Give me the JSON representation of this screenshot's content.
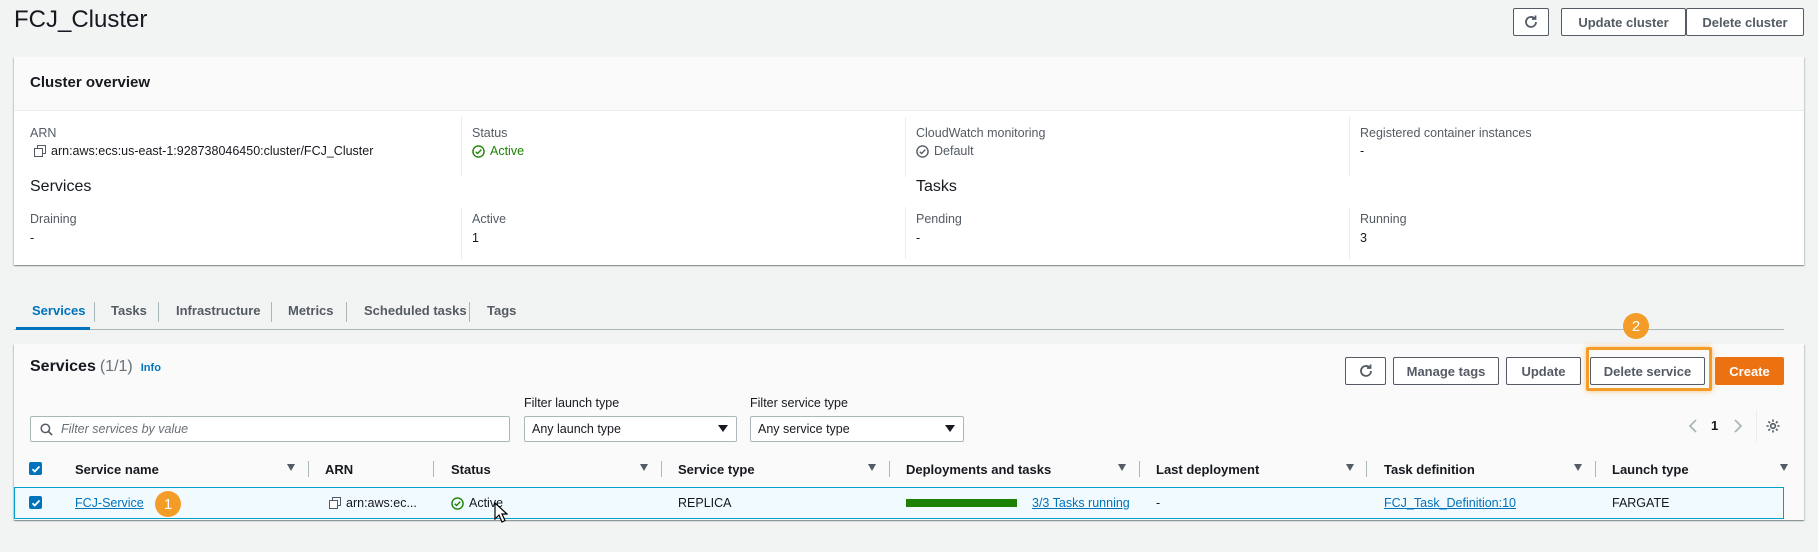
{
  "header": {
    "title": "FCJ_Cluster",
    "update_cluster": "Update cluster",
    "delete_cluster": "Delete cluster"
  },
  "overview": {
    "heading": "Cluster overview",
    "arn_label": "ARN",
    "arn_value": "arn:aws:ecs:us-east-1:928738046450:cluster/FCJ_Cluster",
    "status_label": "Status",
    "status_value": "Active",
    "cloudwatch_label": "CloudWatch monitoring",
    "cloudwatch_value": "Default",
    "registered_label": "Registered container instances",
    "registered_value": "-",
    "services_heading": "Services",
    "draining_label": "Draining",
    "draining_value": "-",
    "active_label": "Active",
    "active_value": "1",
    "tasks_heading": "Tasks",
    "pending_label": "Pending",
    "pending_value": "-",
    "running_label": "Running",
    "running_value": "3"
  },
  "tabs": [
    "Services",
    "Tasks",
    "Infrastructure",
    "Metrics",
    "Scheduled tasks",
    "Tags"
  ],
  "services": {
    "heading": "Services",
    "count": "(1/1)",
    "info": "Info",
    "manage_tags": "Manage tags",
    "update": "Update",
    "delete_service": "Delete service",
    "create": "Create",
    "search_placeholder": "Filter services by value",
    "filter_launch_label": "Filter launch type",
    "filter_launch_value": "Any launch type",
    "filter_service_label": "Filter service type",
    "filter_service_value": "Any service type",
    "page": "1",
    "columns": [
      "Service name",
      "ARN",
      "Status",
      "Service type",
      "Deployments and tasks",
      "Last deployment",
      "Task definition",
      "Launch type"
    ],
    "row": {
      "service_name": "FCJ-Service",
      "arn": "arn:aws:ec...",
      "status": "Active",
      "service_type": "REPLICA",
      "deployment_progress": 1.0,
      "tasks_running": "3/3 Tasks running",
      "last_deployment": "-",
      "task_definition": "FCJ_Task_Definition:10",
      "launch_type": "FARGATE"
    }
  },
  "callouts": [
    "1",
    "2"
  ],
  "colors": {
    "primary": "#ec7211",
    "link": "#0073bb",
    "success": "#1d8102",
    "callout": "#f39c27"
  }
}
